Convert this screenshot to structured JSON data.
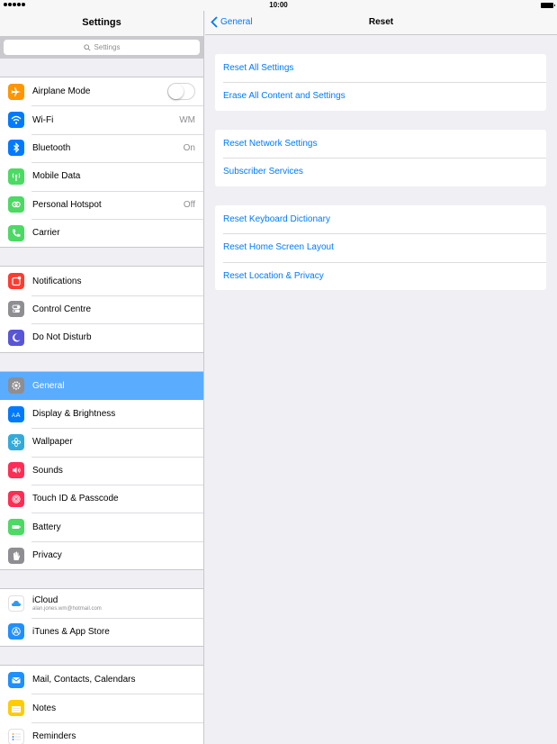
{
  "status_bar": {
    "time": "10:00"
  },
  "sidebar": {
    "title": "Settings",
    "search_placeholder": "Settings",
    "groups": [
      [
        {
          "label": "Airplane Mode",
          "icon": "airplane-icon",
          "color": "#ff9500",
          "toggle": "off"
        },
        {
          "label": "Wi-Fi",
          "icon": "wifi-icon",
          "color": "#007aff",
          "value": "WM"
        },
        {
          "label": "Bluetooth",
          "icon": "bluetooth-icon",
          "color": "#007aff",
          "value": "On"
        },
        {
          "label": "Mobile Data",
          "icon": "antenna-icon",
          "color": "#4cd964"
        },
        {
          "label": "Personal Hotspot",
          "icon": "hotspot-icon",
          "color": "#4cd964",
          "value": "Off"
        },
        {
          "label": "Carrier",
          "icon": "phone-icon",
          "color": "#4cd964"
        }
      ],
      [
        {
          "label": "Notifications",
          "icon": "notifications-icon",
          "color": "#ff3b30"
        },
        {
          "label": "Control Centre",
          "icon": "control-centre-icon",
          "color": "#8e8e93"
        },
        {
          "label": "Do Not Disturb",
          "icon": "moon-icon",
          "color": "#5856d6"
        }
      ],
      [
        {
          "label": "General",
          "icon": "gear-icon",
          "color": "#8e8e93",
          "selected": true
        },
        {
          "label": "Display & Brightness",
          "icon": "display-icon",
          "color": "#007aff"
        },
        {
          "label": "Wallpaper",
          "icon": "wallpaper-icon",
          "color": "#34aadc"
        },
        {
          "label": "Sounds",
          "icon": "speaker-icon",
          "color": "#ff2d55"
        },
        {
          "label": "Touch ID & Passcode",
          "icon": "fingerprint-icon",
          "color": "#ff2d55"
        },
        {
          "label": "Battery",
          "icon": "battery-icon",
          "color": "#4cd964"
        },
        {
          "label": "Privacy",
          "icon": "hand-icon",
          "color": "#8e8e93"
        }
      ],
      [
        {
          "label": "iCloud",
          "icon": "icloud-icon",
          "color": "#ffffff",
          "sublabel": "alan.jones.wm@hotmail.com"
        },
        {
          "label": "iTunes & App Store",
          "icon": "app-store-icon",
          "color": "#1e90ff"
        }
      ],
      [
        {
          "label": "Mail, Contacts, Calendars",
          "icon": "mail-icon",
          "color": "#1e90ff"
        },
        {
          "label": "Notes",
          "icon": "notes-icon",
          "color": "#ffcc00"
        },
        {
          "label": "Reminders",
          "icon": "reminders-icon",
          "color": "#ffffff"
        }
      ]
    ]
  },
  "main": {
    "back_label": "General",
    "title": "Reset",
    "sections": [
      [
        "Reset All Settings",
        "Erase All Content and Settings"
      ],
      [
        "Reset Network Settings",
        "Subscriber Services"
      ],
      [
        "Reset Keyboard Dictionary",
        "Reset Home Screen Layout",
        "Reset Location & Privacy"
      ]
    ]
  },
  "accent_color": "#007aff",
  "selected_color": "#5aacff"
}
